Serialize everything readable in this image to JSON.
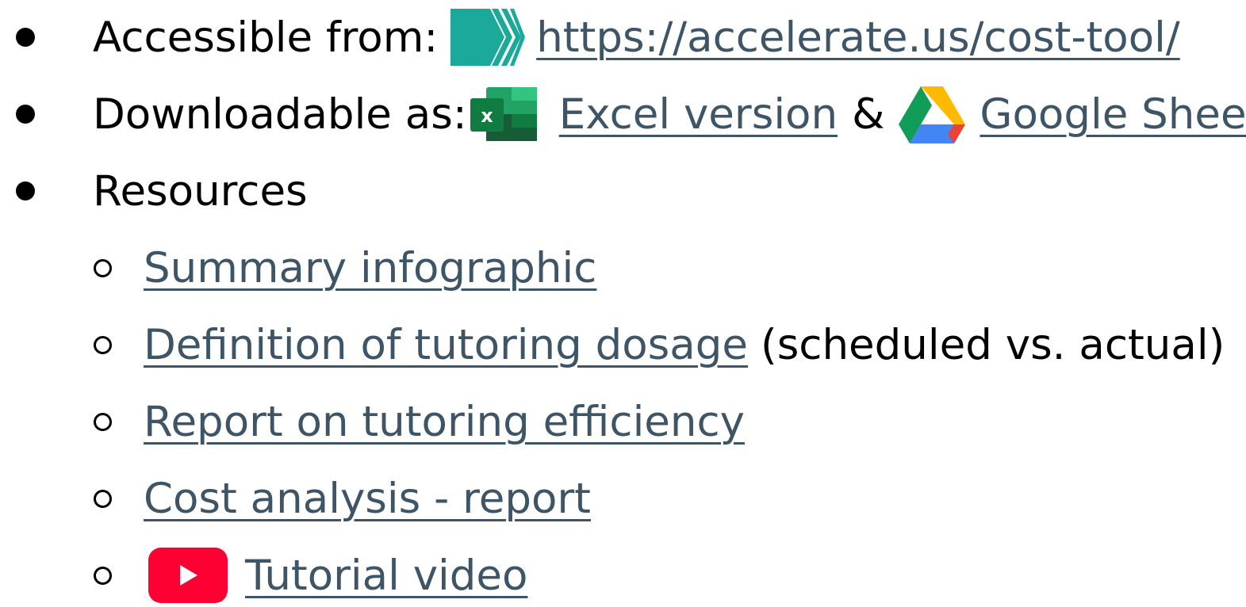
{
  "items": {
    "accessible": {
      "label": "Accessible from: ",
      "icon": "accelerate-logo-icon",
      "link": "https://accelerate.us/cost-tool/"
    },
    "downloadable": {
      "label": "Downloadable as: ",
      "excel_icon": "excel-icon",
      "excel_link": "Excel version",
      "amp": "&",
      "drive_icon": "google-drive-icon",
      "sheet_link": "Google Sheet"
    },
    "resources": {
      "label": "Resources",
      "sub": [
        {
          "link": "Summary infographic"
        },
        {
          "link": "Definition of tutoring dosage",
          "suffix": "(scheduled vs. actual)"
        },
        {
          "link": "Report on tutoring efficiency"
        },
        {
          "link": "Cost analysis - report"
        },
        {
          "link": "Tutorial video",
          "icon": "youtube-icon"
        }
      ]
    }
  },
  "colors": {
    "link": "#3d5566",
    "accelerate_teal": "#1ba99a",
    "excel_green": "#1d6f42",
    "youtube_red": "#ff0033"
  }
}
